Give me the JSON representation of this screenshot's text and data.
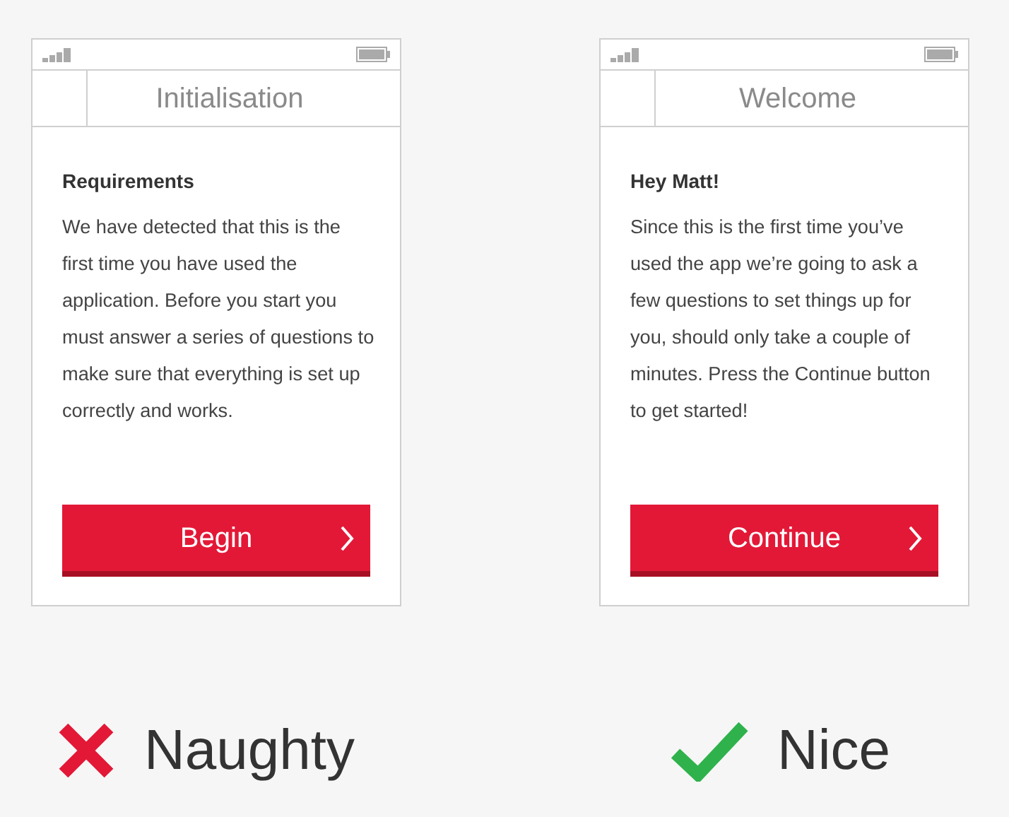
{
  "panels": [
    {
      "screen": {
        "title": "Initialisation",
        "heading": "Requirements",
        "body": "We have detected that this is the first time you have used the application. Before you start you must answer a series of questions to make sure that everything is set up correctly and works.",
        "button": "Begin"
      },
      "verdict": {
        "kind": "bad",
        "label": "Naughty"
      }
    },
    {
      "screen": {
        "title": "Welcome",
        "heading": "Hey Matt!",
        "body": "Since this is the first time you’ve used the app we’re going to ask a few questions to set things up for you, should only take a couple of minutes. Press the Continue button to get started!",
        "button": "Continue"
      },
      "verdict": {
        "kind": "good",
        "label": "Nice"
      }
    }
  ]
}
